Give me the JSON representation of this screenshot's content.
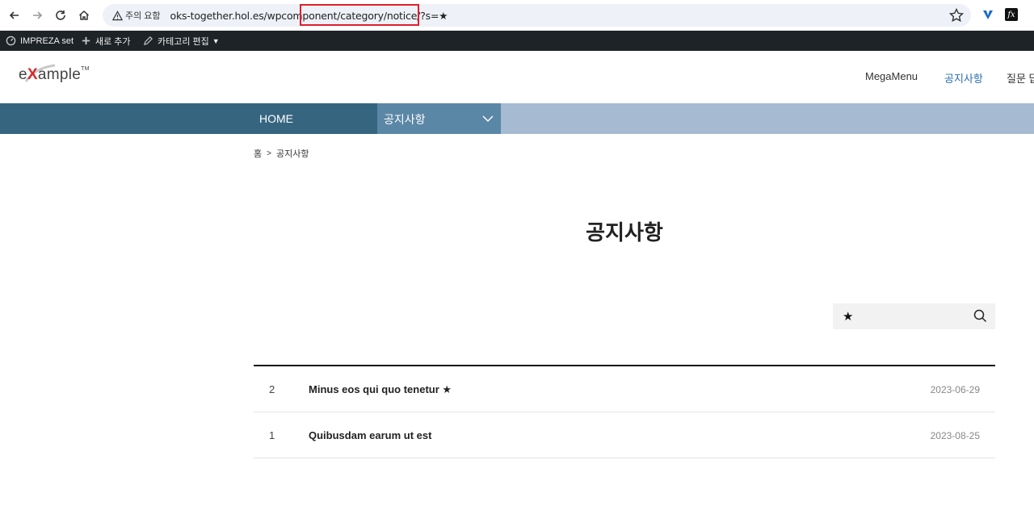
{
  "browser": {
    "security_label": "주의 요함",
    "url": "oks-together.hol.es/wpcomponent/category/notice/?s=★"
  },
  "admin_bar": {
    "site_name": "IMPREZA set",
    "new_label": "새로 추가",
    "edit_label": "카테고리 편집"
  },
  "header": {
    "logo_prefix": "e",
    "logo_x": "X",
    "logo_rest": "ample",
    "logo_tm": "TM",
    "menu": [
      {
        "label": "MegaMenu"
      },
      {
        "label": "공지사항"
      },
      {
        "label": "질문 답"
      }
    ]
  },
  "nav": {
    "home": "HOME",
    "current": "공지사항"
  },
  "breadcrumb": {
    "home": "홈",
    "current": "공지사항"
  },
  "page_title": "공지사항",
  "search": {
    "value": "★"
  },
  "posts": [
    {
      "num": "2",
      "title": "Minus eos qui quo tenetur ★",
      "date": "2023-06-29"
    },
    {
      "num": "1",
      "title": "Quibusdam earum ut est",
      "date": "2023-08-25"
    }
  ],
  "colors": {
    "nav_home_bg": "#366580",
    "nav_current_bg": "#5b87a6",
    "nav_bar_bg": "#a6bad1",
    "active_menu": "#2a6db0",
    "url_highlight": "#e0202a"
  },
  "icons": [
    "back-icon",
    "forward-icon",
    "reload-icon",
    "home-icon",
    "warning-icon",
    "bookmark-star-icon",
    "dashboard-icon",
    "plus-icon",
    "pencil-icon",
    "chevron-down-icon",
    "search-icon"
  ]
}
